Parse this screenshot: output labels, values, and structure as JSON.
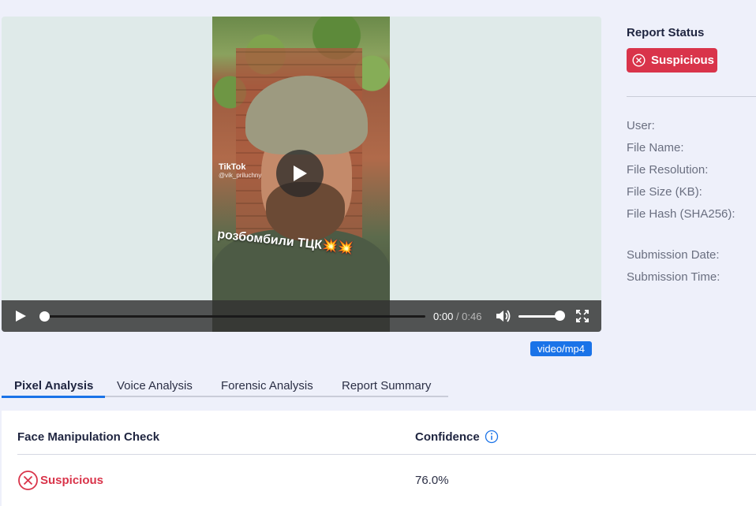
{
  "video": {
    "overlay_brand": "TikTok",
    "overlay_handle": "@vik_priluchny",
    "overlay_caption": "розбомбили ТЦК💥💥",
    "current_time": "0:00",
    "duration": "/ 0:46",
    "progress_fraction": 0.0,
    "volume_fraction": 1.0,
    "mime_type": "video/mp4"
  },
  "report": {
    "title": "Report Status",
    "status": "Suspicious",
    "status_color": "#d9344a",
    "fields": [
      {
        "label": "User:"
      },
      {
        "label": "File Name:"
      },
      {
        "label": "File Resolution:"
      },
      {
        "label": "File Size (KB):"
      },
      {
        "label": "File Hash (SHA256):"
      },
      {
        "label": "Submission Date:"
      },
      {
        "label": "Submission Time:"
      }
    ]
  },
  "tabs": [
    {
      "label": "Pixel Analysis",
      "active": true
    },
    {
      "label": "Voice Analysis",
      "active": false
    },
    {
      "label": "Forensic Analysis",
      "active": false
    },
    {
      "label": "Report Summary",
      "active": false
    }
  ],
  "analysis": {
    "check_header": "Face Manipulation Check",
    "confidence_header": "Confidence",
    "result": "Suspicious",
    "confidence": "76.0%"
  },
  "colors": {
    "accent": "#1a73e8",
    "danger": "#d9344a",
    "background": "#eef0fa"
  }
}
